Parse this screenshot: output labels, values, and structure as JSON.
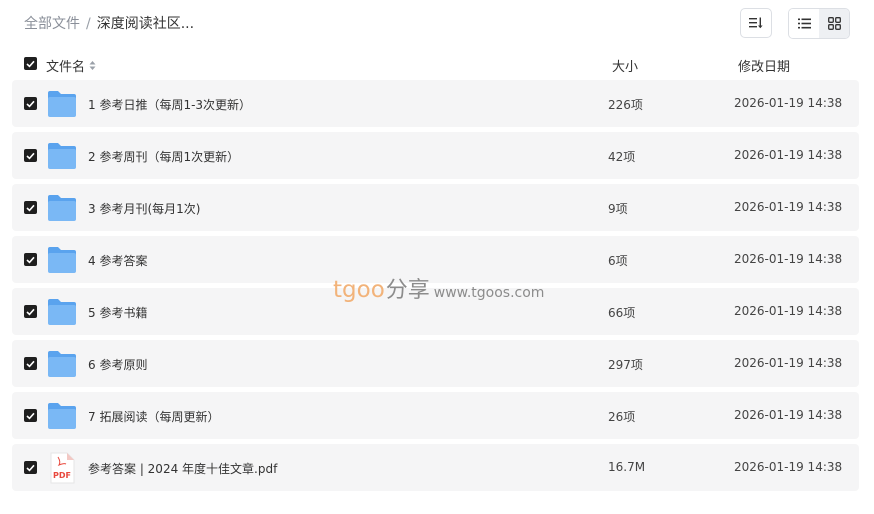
{
  "breadcrumb": {
    "root": "全部文件",
    "separator": "/",
    "current": "深度阅读社区..."
  },
  "toolbar": {
    "sort_icon": "sort-icon",
    "list_view_icon": "list-view-icon",
    "grid_view_icon": "grid-view-icon"
  },
  "columns": {
    "name": "文件名",
    "size": "大小",
    "date": "修改日期"
  },
  "rows": [
    {
      "type": "folder",
      "name": "1 参考日推（每周1-3次更新）",
      "size": "226项",
      "date": "2026-01-19 14:38"
    },
    {
      "type": "folder",
      "name": "2 参考周刊（每周1次更新）",
      "size": "42项",
      "date": "2026-01-19 14:38"
    },
    {
      "type": "folder",
      "name": "3 参考月刊(每月1次)",
      "size": "9项",
      "date": "2026-01-19 14:38"
    },
    {
      "type": "folder",
      "name": "4 参考答案",
      "size": "6项",
      "date": "2026-01-19 14:38"
    },
    {
      "type": "folder",
      "name": "5 参考书籍",
      "size": "66项",
      "date": "2026-01-19 14:38"
    },
    {
      "type": "folder",
      "name": "6 参考原则",
      "size": "297项",
      "date": "2026-01-19 14:38"
    },
    {
      "type": "folder",
      "name": "7 拓展阅读（每周更新）",
      "size": "26项",
      "date": "2026-01-19 14:38"
    },
    {
      "type": "pdf",
      "name": "参考答案 | 2024 年度十佳文章.pdf",
      "size": "16.7M",
      "date": "2026-01-19 14:38"
    }
  ],
  "pdf_icon_label": "PDF",
  "watermark": {
    "brand": "tgoo",
    "cn": "分享",
    "url": "www.tgoos.com"
  },
  "colors": {
    "folder": "#6fb2f5",
    "folder_dark": "#5aa3ee",
    "pdf_red": "#e8483d",
    "row_bg": "#f5f5f6",
    "checkbox": "#1f1f1f"
  }
}
